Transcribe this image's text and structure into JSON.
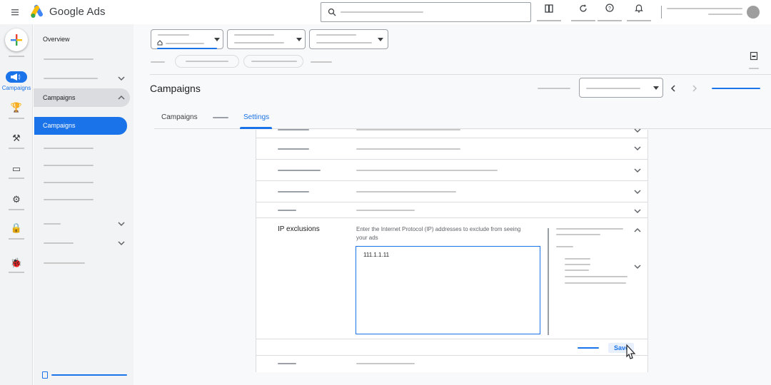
{
  "app": {
    "brand": "Google Ads"
  },
  "icons": {
    "menu": "menu-icon",
    "search": "search-icon",
    "reports": "reports-icon",
    "refresh": "refresh-icon",
    "help": "help-icon",
    "notifications": "bell-icon"
  },
  "rail": {
    "active_label": "Campaigns"
  },
  "sidebar": {
    "overview": "Overview",
    "campaigns_group": "Campaigns",
    "campaigns_active": "Campaigns"
  },
  "main": {
    "page_title": "Campaigns",
    "tabs": [
      {
        "label": "Campaigns",
        "active": false
      },
      {
        "label": "Settings",
        "active": true
      }
    ]
  },
  "ip_exclusions": {
    "title": "IP exclusions",
    "help_text": "Enter the Internet Protocol (IP)  addresses to exclude from seeing your ads",
    "value": "111.1.1.11"
  },
  "footer": {
    "save_label": "Save"
  },
  "colors": {
    "accent": "#1a73e8",
    "sidebar_bg": "#f1f3f4",
    "main_bg": "#f8f9fa"
  }
}
